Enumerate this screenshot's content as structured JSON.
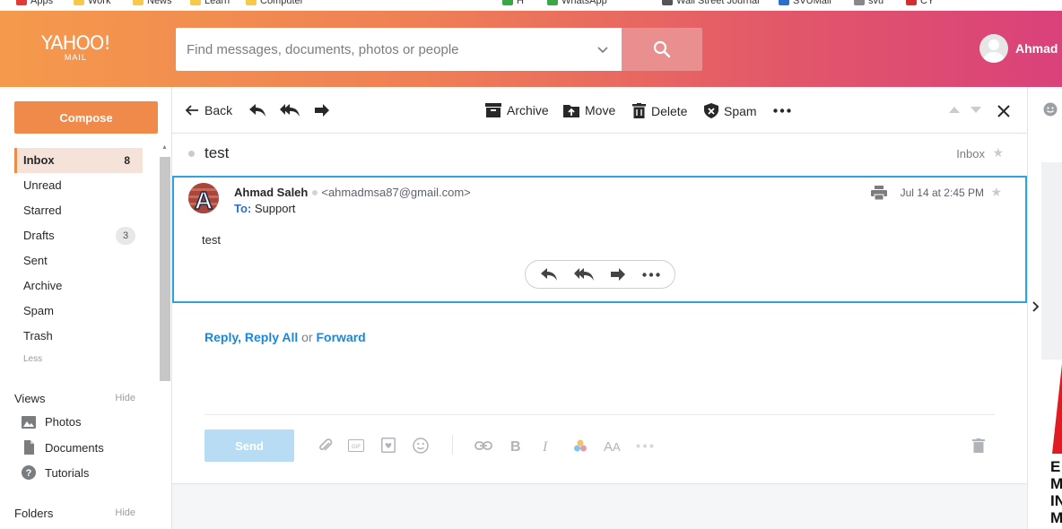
{
  "bookmarks": [
    {
      "label": "Apps",
      "color": "#e53935"
    },
    {
      "label": "Work",
      "color": "#f7c948"
    },
    {
      "label": "News",
      "color": "#f7c948"
    },
    {
      "label": "Learn",
      "color": "#f7c948"
    },
    {
      "label": "Computer",
      "color": "#f7c948"
    },
    {
      "label": "H",
      "color": "#3aa745"
    },
    {
      "label": "WhatsApp",
      "color": "#3aa745"
    },
    {
      "label": "Wall Street Journal",
      "color": "#555555"
    },
    {
      "label": "SVUMail",
      "color": "#2a6fcb"
    },
    {
      "label": "svu",
      "color": "#888888"
    },
    {
      "label": "CY",
      "color": "#d32f2f"
    }
  ],
  "header": {
    "logo_line1": "YAHOO!",
    "logo_line2": "MAIL",
    "search_placeholder": "Find messages, documents, photos or people",
    "user_name": "Ahmad"
  },
  "sidebar": {
    "compose_label": "Compose",
    "items": [
      {
        "label": "Inbox",
        "count": "8",
        "active": true
      },
      {
        "label": "Unread"
      },
      {
        "label": "Starred"
      },
      {
        "label": "Drafts",
        "badge": "3"
      },
      {
        "label": "Sent"
      },
      {
        "label": "Archive"
      },
      {
        "label": "Spam"
      },
      {
        "label": "Trash"
      }
    ],
    "less_label": "Less",
    "views_title": "Views",
    "views_hide": "Hide",
    "views": [
      {
        "label": "Photos",
        "icon": "photos-icon"
      },
      {
        "label": "Documents",
        "icon": "documents-icon"
      },
      {
        "label": "Tutorials",
        "icon": "help-icon"
      }
    ],
    "folders_title": "Folders",
    "folders_hide": "Hide"
  },
  "toolbar": {
    "back_label": "Back",
    "archive_label": "Archive",
    "move_label": "Move",
    "delete_label": "Delete",
    "spam_label": "Spam"
  },
  "message": {
    "subject": "test",
    "folder": "Inbox",
    "sender_name": "Ahmad Saleh",
    "sender_email": "<ahmadmsa87@gmail.com>",
    "to_label": "To:",
    "to_value": "Support",
    "date": "Jul 14 at 2:45 PM",
    "body": "test",
    "avatar_letter": "A"
  },
  "reply": {
    "reply_label": "Reply",
    "reply_all_label": "Reply All",
    "or_label": "or",
    "forward_label": "Forward",
    "send_label": "Send",
    "gif_label": "GIF"
  },
  "colors": {
    "accent": "#f08a4b",
    "link": "#1d86d6",
    "selected_border": "#2fa3e1"
  }
}
